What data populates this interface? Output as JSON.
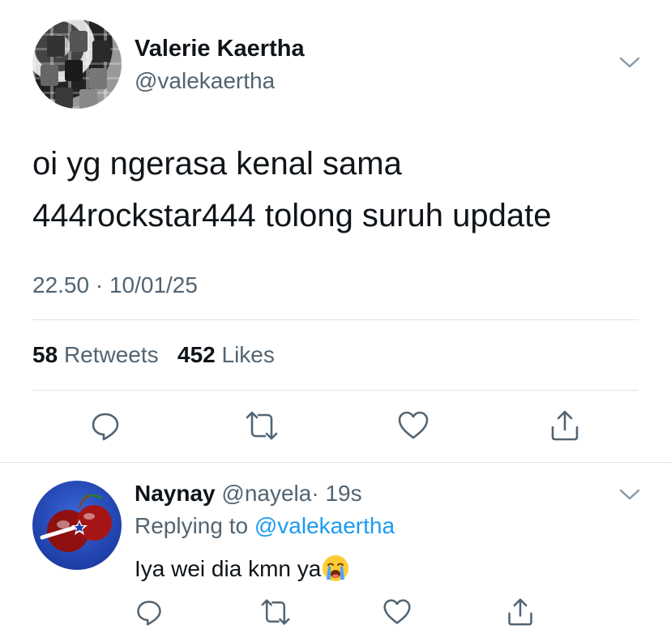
{
  "tweet": {
    "author_name": "Valerie Kaertha",
    "author_handle": "@valekaertha",
    "text_lines": [
      "oi yg ngerasa kenal sama",
      "444rockstar444 tolong suruh update"
    ],
    "timestamp": "22.50 · 10/01/25",
    "retweets_count": "58",
    "retweets_label": "Retweets",
    "likes_count": "452",
    "likes_label": "Likes"
  },
  "reply": {
    "author_name": "Naynay",
    "author_handle": "@nayela",
    "time_ago": "· 19s",
    "replying_prefix": "Replying to",
    "replying_mention": "@valekaertha",
    "text": "Iya wei dia kmn ya",
    "emoji": "loudly-crying-face-icon"
  },
  "icons": {
    "menu": "chevron-down-icon",
    "reply": "comment-icon",
    "retweet": "retweet-icon",
    "like": "heart-icon",
    "share": "share-icon"
  },
  "colors": {
    "text": "#0f1419",
    "secondary": "#536471",
    "link": "#1d9bf0",
    "divider": "#dfe3e7"
  }
}
